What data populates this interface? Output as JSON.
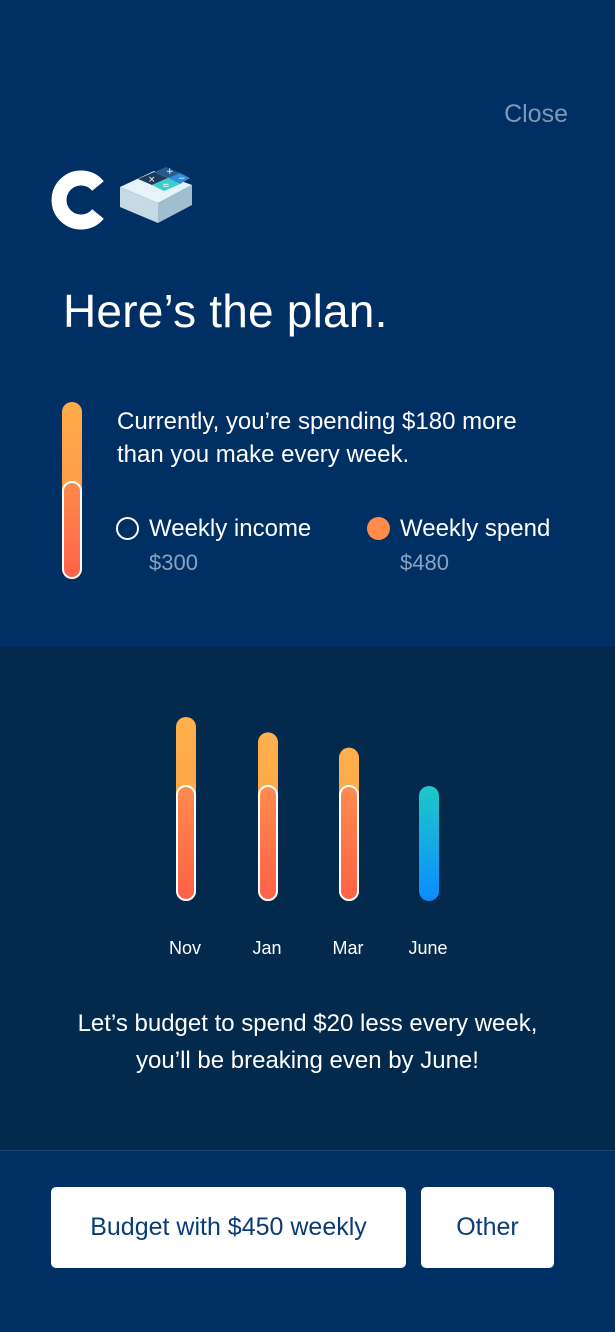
{
  "header": {
    "close_label": "Close"
  },
  "headline": "Here’s the plan.",
  "summary": {
    "description": "Currently, you’re spending $180 more than you make every week.",
    "income": {
      "label": "Weekly income",
      "amount": "$300"
    },
    "spend": {
      "label": "Weekly spend",
      "amount": "$480"
    },
    "spend_share_income": 0.625
  },
  "chart_data": {
    "type": "bar",
    "categories": [
      "Nov",
      "Jan",
      "Mar",
      "June"
    ],
    "series": [
      {
        "values": [
          480,
          440,
          400,
          300
        ]
      },
      {
        "values": [
          300,
          300,
          300,
          300
        ]
      }
    ],
    "ylim": [
      0,
      480
    ],
    "colors": {
      "spend": "#ffa24a",
      "income": "#ff6b48",
      "goal_top": "#1ec8c8",
      "goal_bottom": "#0a8dff"
    }
  },
  "message": {
    "line1": "Let’s budget to spend $20 less every week,",
    "line2": "you’ll be breaking even by June!"
  },
  "actions": {
    "primary_label": "Budget with $450 weekly",
    "other_label": "Other"
  },
  "icons": {
    "logo": "brand-c-icon",
    "calculator": "calculator-icon"
  }
}
